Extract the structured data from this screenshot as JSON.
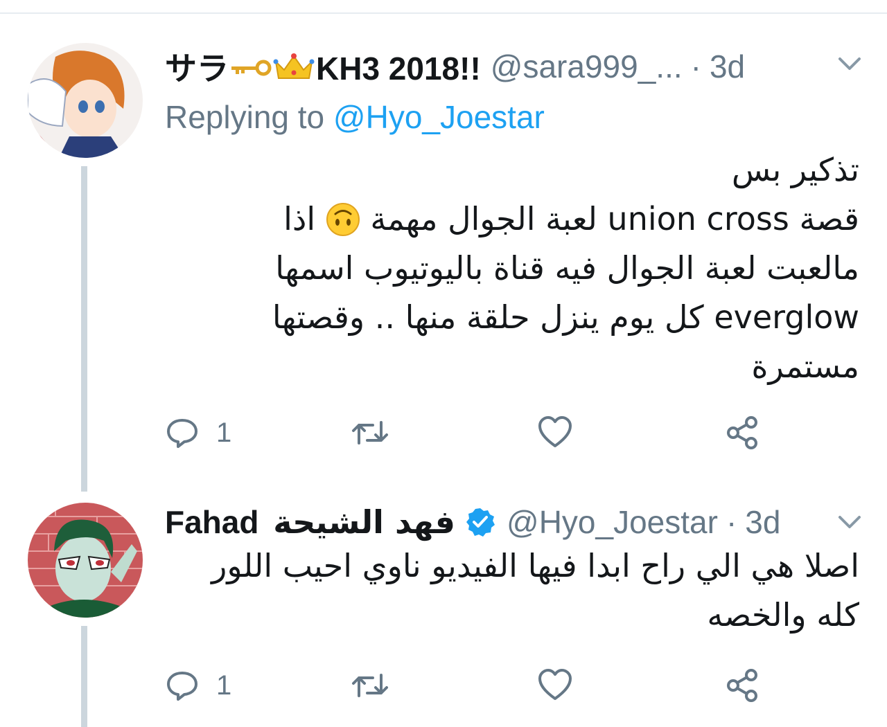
{
  "tweets": [
    {
      "display_name": "サラ🗝👑KH3 2018!!",
      "display_name_parts": {
        "prefix": "サラ",
        "suffix": "KH3 2018!!"
      },
      "handle": "@sara999_...",
      "separator": "·",
      "time": "3d",
      "replying_label": "Replying to",
      "replying_mention": "@Hyo_Joestar",
      "text_lines": [
        "تذكير بس",
        "قصة union cross لعبة الجوال مهمة",
        "اذا",
        "مالعبت لعبة الجوال فيه قناة باليوتيوب اسمها",
        "everglow كل يوم ينزل حلقة منها .. وقصتها",
        "مستمرة"
      ],
      "emoji": "upside-down-face",
      "reply_count": "1",
      "retweet_count": "",
      "like_count": ""
    },
    {
      "display_name": "Fahad فهد الشيحة",
      "display_name_latin": "Fahad",
      "display_name_arabic": "فهد الشيحة",
      "verified": true,
      "handle": "@Hyo_Joestar",
      "separator": "·",
      "time": "3d",
      "text_lines": [
        "اصلا هي الي راح ابدا فيها الفيديو ناوي احيب اللور",
        "كله والخصه"
      ],
      "reply_count": "1",
      "retweet_count": "",
      "like_count": ""
    }
  ],
  "icons": {
    "reply": "reply-icon",
    "retweet": "retweet-icon",
    "like": "heart-icon",
    "share": "share-icon",
    "more": "chevron-down-icon",
    "verified": "verified-badge-icon"
  },
  "colors": {
    "text": "#14171a",
    "muted": "#657786",
    "accent": "#1da1f2",
    "thread_line": "#ccd6dd"
  }
}
